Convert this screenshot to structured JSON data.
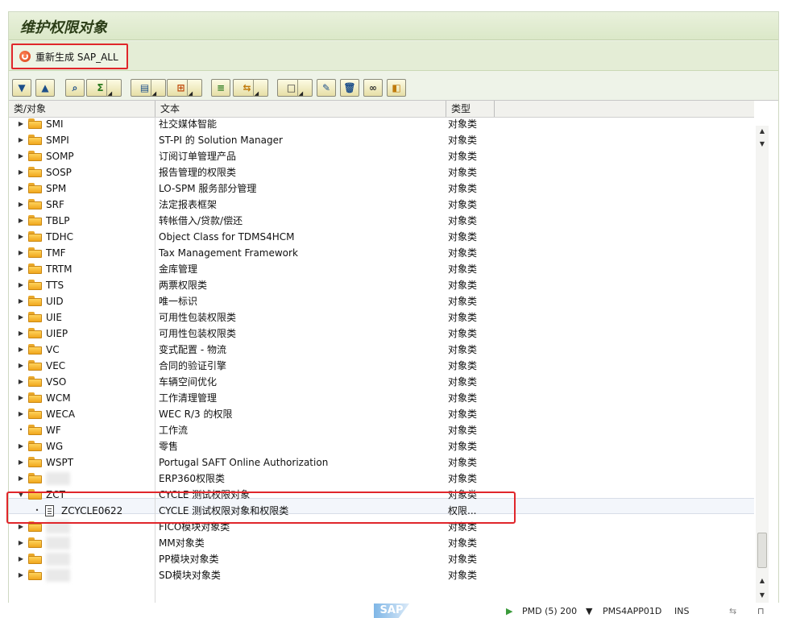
{
  "title": "维护权限对象",
  "app_toolbar": {
    "regenerate_label": "重新生成 SAP_ALL"
  },
  "tree_toolbar": {
    "buttons": [
      "expand-all-icon",
      "collapse-all-icon",
      "find-icon",
      "sum-icon",
      "print-icon",
      "layout-icon",
      "subtotal-icon",
      "export-icon",
      "new-icon",
      "edit-icon",
      "delete-icon",
      "binoculars-icon",
      "details-icon"
    ]
  },
  "columns": {
    "class": "类/对象",
    "text": "文本",
    "type": "类型"
  },
  "rows": [
    {
      "class": "SMI",
      "text": "社交媒体智能",
      "type": "对象类"
    },
    {
      "class": "SMPI",
      "text": "ST-PI 的 Solution Manager",
      "type": "对象类"
    },
    {
      "class": "SOMP",
      "text": "订阅订单管理产品",
      "type": "对象类"
    },
    {
      "class": "SOSP",
      "text": "报告管理的权限类",
      "type": "对象类"
    },
    {
      "class": "SPM",
      "text": "LO-SPM 服务部分管理",
      "type": "对象类"
    },
    {
      "class": "SRF",
      "text": "法定报表框架",
      "type": "对象类"
    },
    {
      "class": "TBLP",
      "text": "转帐借入/贷款/偿还",
      "type": "对象类"
    },
    {
      "class": "TDHC",
      "text": "Object Class for TDMS4HCM",
      "type": "对象类"
    },
    {
      "class": "TMF",
      "text": "Tax Management Framework",
      "type": "对象类"
    },
    {
      "class": "TRTM",
      "text": "金库管理",
      "type": "对象类"
    },
    {
      "class": "TTS",
      "text": "两票权限类",
      "type": "对象类"
    },
    {
      "class": "UID",
      "text": "唯一标识",
      "type": "对象类"
    },
    {
      "class": "UIE",
      "text": "可用性包装权限类",
      "type": "对象类"
    },
    {
      "class": "UIEP",
      "text": "可用性包装权限类",
      "type": "对象类"
    },
    {
      "class": "VC",
      "text": "变式配置 - 物流",
      "type": "对象类"
    },
    {
      "class": "VEC",
      "text": "合同的验证引擎",
      "type": "对象类"
    },
    {
      "class": "VSO",
      "text": "车辆空间优化",
      "type": "对象类"
    },
    {
      "class": "WCM",
      "text": "工作清理管理",
      "type": "对象类"
    },
    {
      "class": "WECA",
      "text": "WEC R/3 的权限",
      "type": "对象类"
    },
    {
      "class": "WF",
      "text": "工作流",
      "type": "对象类"
    },
    {
      "class": "WG",
      "text": "零售",
      "type": "对象类"
    },
    {
      "class": "WSPT",
      "text": "Portugal SAFT Online Authorization",
      "type": "对象类"
    },
    {
      "class": "",
      "text": "ERP360权限类",
      "type": "对象类"
    },
    {
      "class": "ZCT",
      "text": "CYCLE 测试权限对象",
      "type": "对象类"
    },
    {
      "class": "ZCYCLE0622",
      "text": "CYCLE 测试权限对象和权限类",
      "type": "权限..."
    },
    {
      "class": "",
      "text": "FICO模块对象类",
      "type": "对象类"
    },
    {
      "class": "",
      "text": "MM对象类",
      "type": "对象类"
    },
    {
      "class": "",
      "text": "PP模块对象类",
      "type": "对象类"
    },
    {
      "class": "",
      "text": "SD模块对象类",
      "type": "对象类"
    }
  ],
  "status": {
    "system": "PMD (5) 200",
    "server": "PMS4APP01D",
    "mode": "INS",
    "logo": "SAP"
  }
}
